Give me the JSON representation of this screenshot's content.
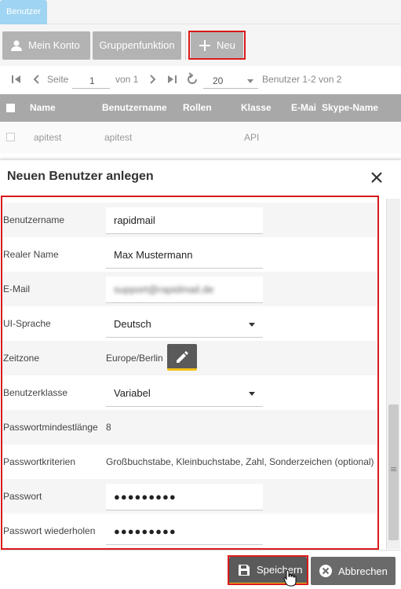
{
  "tab": {
    "label": "Benutzer"
  },
  "toolbar": {
    "konto_label": "Mein Konto",
    "gruppe_label": "Gruppenfunktion",
    "neu_label": "Neu"
  },
  "pager": {
    "seite_label": "Seite",
    "page": "1",
    "von_label": "von 1",
    "page_size": "20",
    "summary": "Benutzer 1-2 von 2"
  },
  "grid": {
    "columns": [
      "Name",
      "Benutzername",
      "Rollen",
      "Klasse",
      "E-Mai",
      "Skype-Name"
    ],
    "rows": [
      {
        "name": "apitest",
        "benutzername": "apitest",
        "rollen": "",
        "klasse": "API",
        "email": "",
        "skype": ""
      }
    ]
  },
  "modal": {
    "title": "Neuen Benutzer anlegen",
    "fields": {
      "benutzername": {
        "label": "Benutzername",
        "value": "rapidmail"
      },
      "realer_name": {
        "label": "Realer Name",
        "value": "Max Mustermann"
      },
      "email": {
        "label": "E-Mail",
        "value": "support@rapidmail.de"
      },
      "ui_sprache": {
        "label": "UI-Sprache",
        "value": "Deutsch"
      },
      "zeitzone": {
        "label": "Zeitzone",
        "value": "Europe/Berlin"
      },
      "benutzerklasse": {
        "label": "Benutzerklasse",
        "value": "Variabel"
      },
      "pw_min": {
        "label": "Passwortmindestlänge",
        "value": "8"
      },
      "pw_krit": {
        "label": "Passwortkriterien",
        "value": "Großbuchstabe, Kleinbuchstabe, Zahl, Sonderzeichen (optional)"
      },
      "passwort": {
        "label": "Passwort",
        "value": "●●●●●●●●●"
      },
      "passwort2": {
        "label": "Passwort wiederholen",
        "value": "●●●●●●●●●"
      }
    },
    "save_label": "Speichern",
    "cancel_label": "Abbrechen"
  },
  "colors": {
    "highlight": "#d9191a",
    "accent": "#f5c016",
    "button": "#5a5a5a",
    "tab": "#9fd4f2"
  },
  "icons": [
    "user-icon",
    "plus-icon",
    "first-page-icon",
    "prev-page-icon",
    "next-page-icon",
    "last-page-icon",
    "refresh-icon",
    "close-icon",
    "edit-icon",
    "save-icon",
    "cancel-icon",
    "hand-cursor-icon"
  ]
}
